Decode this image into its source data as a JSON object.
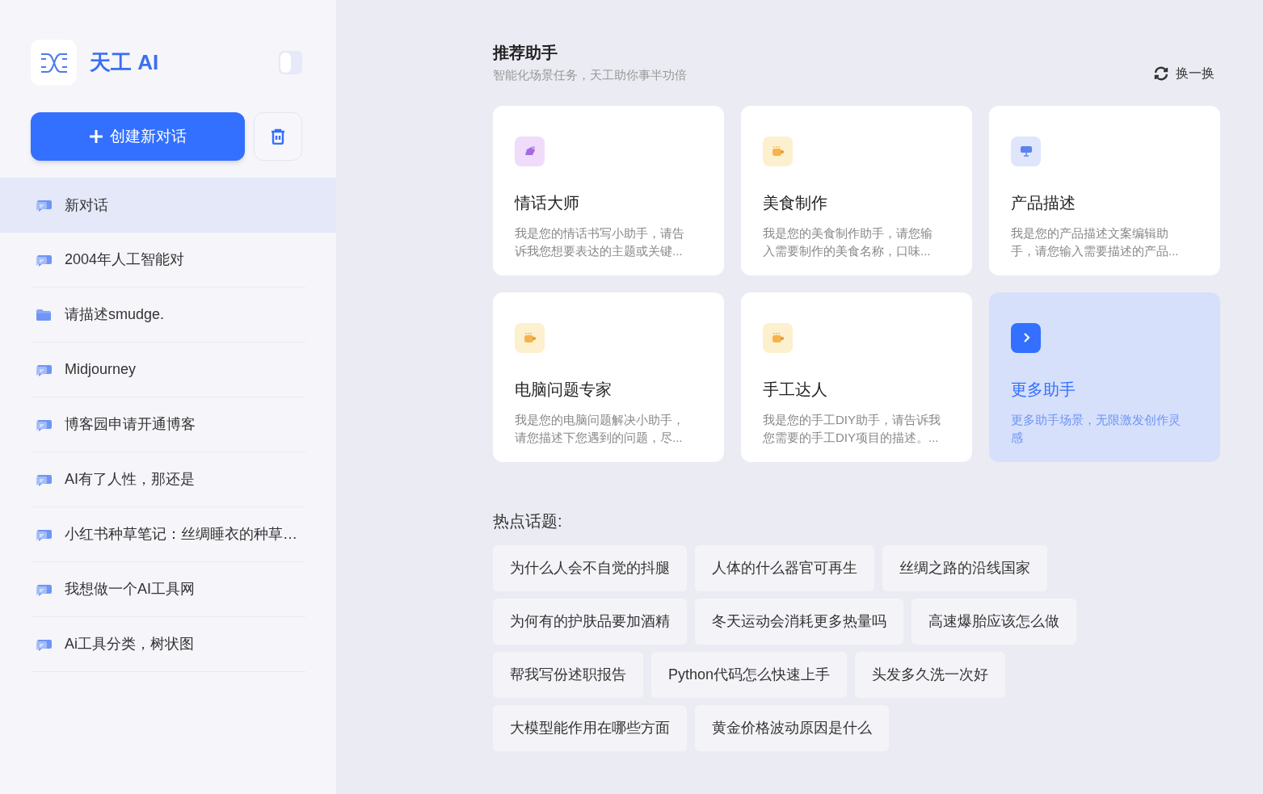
{
  "brand": {
    "name": "天工 AI"
  },
  "sidebar": {
    "new_chat_button": "创建新对话",
    "theme_toggle": {
      "on": false
    },
    "items": [
      {
        "kind": "chat",
        "label": "新对话",
        "selected": true
      },
      {
        "kind": "chat",
        "label": "2004年人工智能对",
        "selected": false
      },
      {
        "kind": "folder",
        "label": "请描述smudge.",
        "selected": false
      },
      {
        "kind": "chat",
        "label": "Midjourney",
        "selected": false
      },
      {
        "kind": "chat",
        "label": "博客园申请开通博客",
        "selected": false
      },
      {
        "kind": "chat",
        "label": "AI有了人性，那还是",
        "selected": false
      },
      {
        "kind": "chat",
        "label": "小红书种草笔记：丝绸睡衣的种草…",
        "selected": false
      },
      {
        "kind": "chat",
        "label": "我想做一个AI工具网",
        "selected": false
      },
      {
        "kind": "chat",
        "label": "Ai工具分类，树状图",
        "selected": false
      }
    ]
  },
  "recommend": {
    "title": "推荐助手",
    "subtitle": "智能化场景任务，天工助你事半功倍",
    "refresh": "换一换",
    "cards": [
      {
        "kind": "pen",
        "title": "情话大师",
        "description": "我是您的情话书写小助手，请告诉我您想要表达的主题或关键..."
      },
      {
        "kind": "cup",
        "title": "美食制作",
        "description": "我是您的美食制作助手，请您输入需要制作的美食名称，口味..."
      },
      {
        "kind": "monitor",
        "title": "产品描述",
        "description": "我是您的产品描述文案编辑助手，请您输入需要描述的产品..."
      },
      {
        "kind": "cup",
        "title": "电脑问题专家",
        "description": "我是您的电脑问题解决小助手，请您描述下您遇到的问题，尽..."
      },
      {
        "kind": "cup",
        "title": "手工达人",
        "description": "我是您的手工DIY助手，请告诉我您需要的手工DIY项目的描述。..."
      },
      {
        "kind": "more",
        "title": "更多助手",
        "description": "更多助手场景，无限激发创作灵感"
      }
    ]
  },
  "hot_topics": {
    "title": "热点话题:",
    "items": [
      "为什么人会不自觉的抖腿",
      "人体的什么器官可再生",
      "丝绸之路的沿线国家",
      "为何有的护肤品要加酒精",
      "冬天运动会消耗更多热量吗",
      "高速爆胎应该怎么做",
      "帮我写份述职报告",
      "Python代码怎么快速上手",
      "头发多久洗一次好",
      "大模型能作用在哪些方面",
      "黄金价格波动原因是什么"
    ]
  }
}
